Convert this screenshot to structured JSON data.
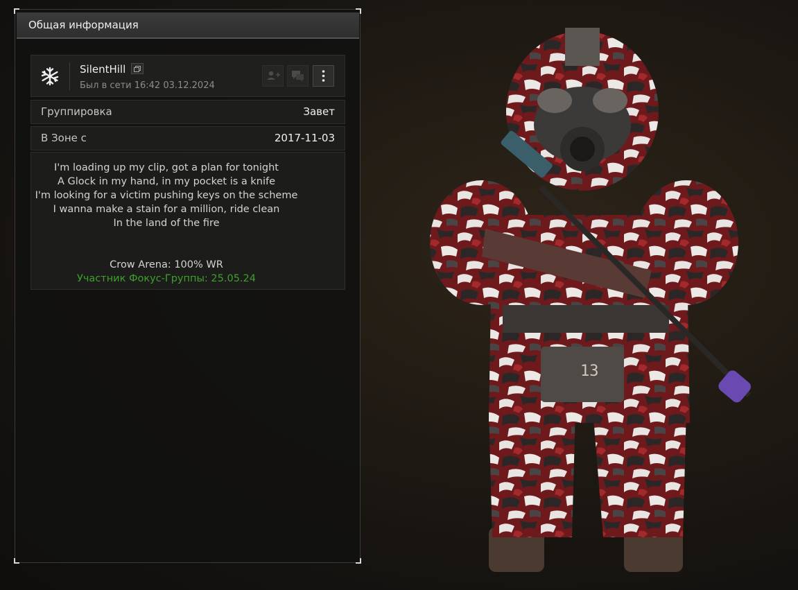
{
  "panel": {
    "title": "Общая информация",
    "profile": {
      "username": "SilentHill",
      "last_seen": "Был в сети 16:42 03.12.2024",
      "avatar_icon": "snowflake-emblem-icon",
      "actions": [
        {
          "icon": "add-friend-icon"
        },
        {
          "icon": "chat-icon"
        },
        {
          "icon": "more-vertical-icon"
        }
      ]
    },
    "faction": {
      "label": "Группировка",
      "value": "Завет"
    },
    "zone_since": {
      "label": "В Зоне с",
      "value": "2017-11-03"
    },
    "bio": {
      "lines": [
        "I'm loading up my clip, got a plan for tonight",
        "A Glock in my hand, in my pocket is a knife",
        "I'm looking for a victim pushing keys on the scheme",
        "I wanna make a stain for a million, ride clean",
        "In the land of the fire"
      ],
      "arena": "Crow Arena: 100% WR",
      "focus_group": "Участник Фокус-Группы: 25.05.24",
      "focus_group_color": "#3fa02c"
    }
  },
  "colors": {
    "panel_bg": "#111110",
    "header_bg": "#333333",
    "camo_red": "#8a1f1f"
  }
}
